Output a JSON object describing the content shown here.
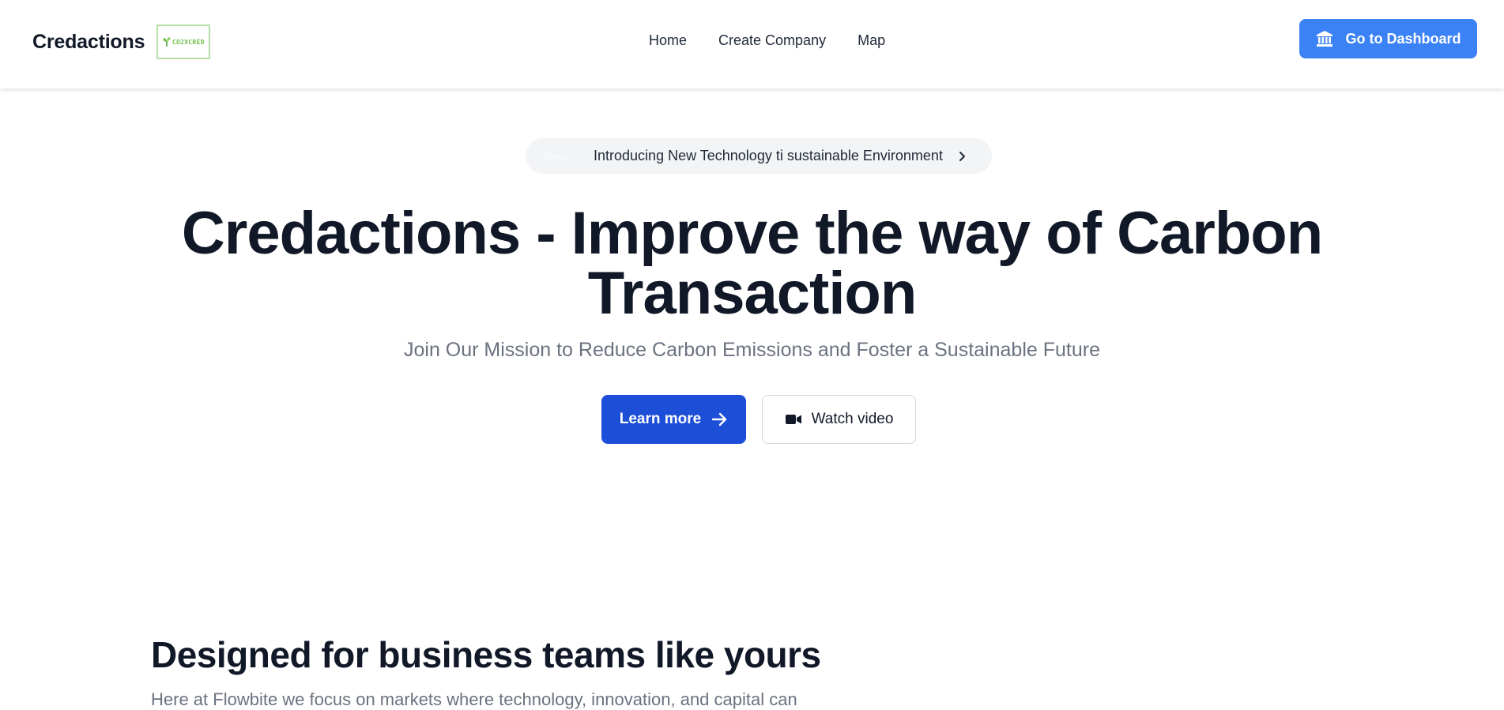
{
  "header": {
    "brand_name": "Credactions",
    "logo_text": "CO2XCRED",
    "nav": [
      {
        "label": "Home"
      },
      {
        "label": "Create Company"
      },
      {
        "label": "Map"
      }
    ],
    "dashboard_button": {
      "label": "Go to Dashboard",
      "icon": "bank-icon"
    }
  },
  "hero": {
    "announcement": {
      "badge": "New",
      "text": "Introducing New Technology ti sustainable Environment",
      "icon": "chevron-right-icon"
    },
    "title_line1": "Credactions - Improve the way of Carbon",
    "title_line2": "Transaction",
    "subtitle": "Join Our Mission to Reduce Carbon Emissions and Foster a Sustainable Future",
    "learn_more": {
      "label": "Learn more",
      "icon": "arrow-right-icon"
    },
    "watch_video": {
      "label": "Watch video",
      "icon": "video-camera-icon"
    }
  },
  "section": {
    "title": "Designed for business teams like yours",
    "body": "Here at Flowbite we focus on markets where technology, innovation, and capital can"
  },
  "colors": {
    "primary_button": "#1d4ed8",
    "dashboard_button": "#3b82f6",
    "heading": "#111827",
    "muted_text": "#6b7280",
    "pill_background": "#f3f4f6",
    "logo_green": "#6cbf45"
  }
}
